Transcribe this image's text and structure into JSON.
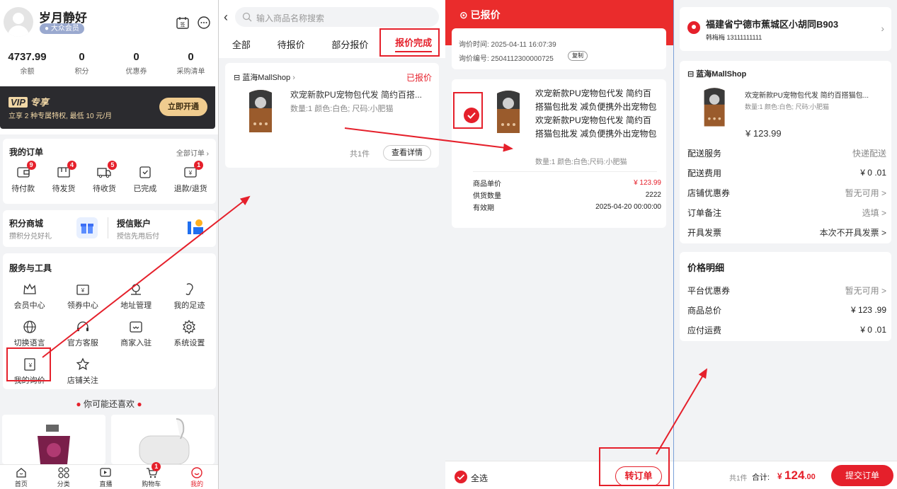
{
  "p1": {
    "user_name": "岁月静好",
    "member_tag": "大众会员",
    "stats": [
      {
        "value": "4737.99",
        "label": "余额"
      },
      {
        "value": "0",
        "label": "积分"
      },
      {
        "value": "0",
        "label": "优惠券"
      },
      {
        "value": "0",
        "label": "采购清单"
      }
    ],
    "vip": {
      "badge": "VIP",
      "title": "专享",
      "desc": "立享 2 种专属特权, 最低 10 元/月",
      "button": "立即开通"
    },
    "orders": {
      "title": "我的订单",
      "all": "全部订单",
      "items": [
        {
          "label": "待付款",
          "badge": "9"
        },
        {
          "label": "待发货",
          "badge": "4"
        },
        {
          "label": "待收货",
          "badge": "5"
        },
        {
          "label": "已完成",
          "badge": ""
        },
        {
          "label": "退款/退货",
          "badge": "1"
        }
      ]
    },
    "points_mall": {
      "title": "积分商城",
      "sub": "攒积分兑好礼"
    },
    "credit": {
      "title": "授信账户",
      "sub": "授信先用后付"
    },
    "services": {
      "title": "服务与工具",
      "items": [
        "会员中心",
        "领券中心",
        "地址管理",
        "我的足迹",
        "切换语言",
        "官方客服",
        "商家入驻",
        "系统设置",
        "我的询价",
        "店铺关注"
      ]
    },
    "recommend": "你可能还喜欢",
    "nav": [
      {
        "label": "首页",
        "badge": ""
      },
      {
        "label": "分类",
        "badge": ""
      },
      {
        "label": "直播",
        "badge": ""
      },
      {
        "label": "购物车",
        "badge": "1"
      },
      {
        "label": "我的",
        "badge": ""
      }
    ]
  },
  "p2": {
    "search_placeholder": "输入商品名称搜索",
    "tabs": [
      "全部",
      "待报价",
      "部分报价",
      "报价完成"
    ],
    "shop": "蓝海MallShop",
    "status": "已报价",
    "product_title": "欢宠新款PU宠物包代发 简约百搭...",
    "product_spec": "数量:1  颜色:白色; 尺码:小肥猫",
    "count": "共1件",
    "detail_button": "查看详情"
  },
  "p3": {
    "header": "已报价",
    "time_label": "询价时间: 2025-04-11 16:07:39",
    "no_label": "询价编号: 2504112300000725",
    "copy": "复制",
    "product_title": "欢宠新款PU宠物包代发 简约百搭猫包批发 减负便携外出宠物包欢宠新款PU宠物包代发 简约百搭猫包批发 减负便携外出宠物包",
    "product_spec": "数量:1  颜色:白色;尺码:小肥猫",
    "rows": [
      {
        "label": "商品单价",
        "value": "¥ 123.99"
      },
      {
        "label": "供货数量",
        "value": "2222"
      },
      {
        "label": "有效期",
        "value": "2025-04-20 00:00:00"
      }
    ],
    "select_all": "全选",
    "convert_button": "转订单"
  },
  "p4": {
    "address": "福建省宁德市蕉城区小胡同B903",
    "contact": "韩梅梅 13111111111",
    "shop": "蓝海MallShop",
    "product_title": "欢宠新款PU宠物包代发 简约百搭猫包...",
    "product_spec": "数量:1  颜色:白色; 尺码:小肥猫",
    "price": "¥ 123.99",
    "rows": [
      {
        "label": "配送服务",
        "value": "快递配送"
      },
      {
        "label": "配送费用",
        "value": "¥ 0 .01"
      },
      {
        "label": "店铺优惠券",
        "value": "暂无可用 >"
      },
      {
        "label": "订单备注",
        "value": "选填 >"
      },
      {
        "label": "开具发票",
        "value": "本次不开具发票 >"
      }
    ],
    "price_title": "价格明细",
    "price_rows": [
      {
        "label": "平台优惠券",
        "value": "暂无可用 >"
      },
      {
        "label": "商品总价",
        "value": "¥ 123 .99"
      },
      {
        "label": "应付运费",
        "value": "¥ 0 .01"
      }
    ],
    "count": "共1件",
    "total_label": "合计:",
    "total_symbol": "¥",
    "total_int": "124",
    "total_dec": ".00",
    "submit": "提交订单"
  }
}
